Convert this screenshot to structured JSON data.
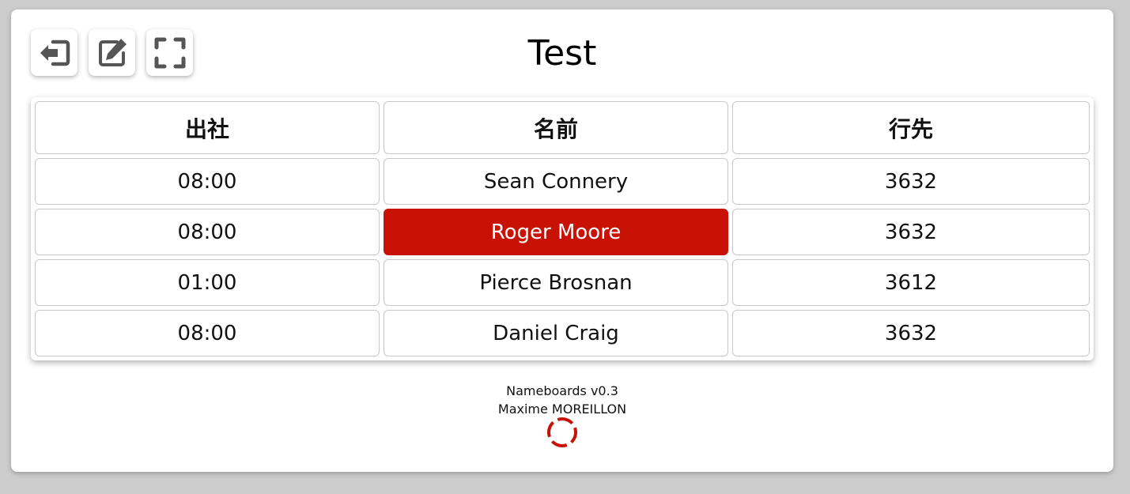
{
  "toolbar": {
    "buttons": [
      {
        "name": "exit-button",
        "icon": "sign-out-icon"
      },
      {
        "name": "edit-button",
        "icon": "edit-icon"
      },
      {
        "name": "fullscreen-button",
        "icon": "fullscreen-icon"
      }
    ]
  },
  "title": "Test",
  "table": {
    "headers": [
      "出社",
      "名前",
      "行先"
    ],
    "rows": [
      {
        "time": "08:00",
        "name": "Sean Connery",
        "destination": "3632",
        "highlighted": false
      },
      {
        "time": "08:00",
        "name": "Roger Moore",
        "destination": "3632",
        "highlighted": true
      },
      {
        "time": "01:00",
        "name": "Pierce Brosnan",
        "destination": "3612",
        "highlighted": false
      },
      {
        "time": "08:00",
        "name": "Daniel Craig",
        "destination": "3632",
        "highlighted": false
      }
    ]
  },
  "footer": {
    "app_version": "Nameboards v0.3",
    "author": "Maxime MOREILLON"
  },
  "colors": {
    "accent": "#c81205",
    "icon": "#555555"
  }
}
